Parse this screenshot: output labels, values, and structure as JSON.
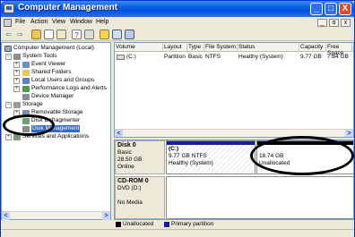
{
  "window": {
    "title": "Computer Management",
    "minimize_glyph": "_",
    "maximize_glyph": "□",
    "close_glyph": "X"
  },
  "menu": {
    "items": [
      "File",
      "Action",
      "View",
      "Window",
      "Help"
    ],
    "mdi_min": "_",
    "mdi_restore": "ɑ",
    "mdi_close": "x"
  },
  "toolbar": {
    "buttons": [
      "back-icon",
      "forward-icon",
      "up-folder-icon",
      "show-tree-icon",
      "properties-icon",
      "help-icon",
      "settings-icon",
      "open-icon",
      "search-icon",
      "disk-icon"
    ]
  },
  "tree": {
    "root": "Computer Management (Local)",
    "system_tools": "System Tools",
    "event_viewer": "Event Viewer",
    "shared_folders": "Shared Folders",
    "local_users": "Local Users and Groups",
    "performance": "Performance Logs and Alerts",
    "device_manager": "Device Manager",
    "storage": "Storage",
    "removable": "Removable Storage",
    "defrag": "Disk Defragmenter",
    "disk_mgmt": "Disk Management",
    "services": "Services and Applications"
  },
  "volume_list": {
    "headers": [
      "Volume",
      "Layout",
      "Type",
      "File System",
      "Status",
      "Capacity",
      "Free Space",
      "%"
    ],
    "rows": [
      [
        "(C:)",
        "Partition",
        "Basic",
        "NTFS",
        "Healthy (System)",
        "9.77 GB",
        "7.84 GB",
        "80"
      ]
    ]
  },
  "disks": {
    "disk0": {
      "name": "Disk 0",
      "type": "Basic",
      "size": "28.50 GB",
      "status": "Online"
    },
    "disk0_part_c": {
      "label": "(C:)",
      "fs": "9.77 GB NTFS",
      "status": "Healthy (System)"
    },
    "disk0_unalloc": {
      "size": "18.74 GB",
      "label": "Unallocated"
    },
    "cdrom0": {
      "name": "CD-ROM 0",
      "drive": "DVD (D:)",
      "media": "No Media"
    }
  },
  "legend": {
    "unallocated": "Unallocated",
    "primary": "Primary partition"
  },
  "colors": {
    "accent": "#0054e3",
    "unallocated": "#000000",
    "primary": "#1a1aa6",
    "selected": "#316ac5"
  }
}
